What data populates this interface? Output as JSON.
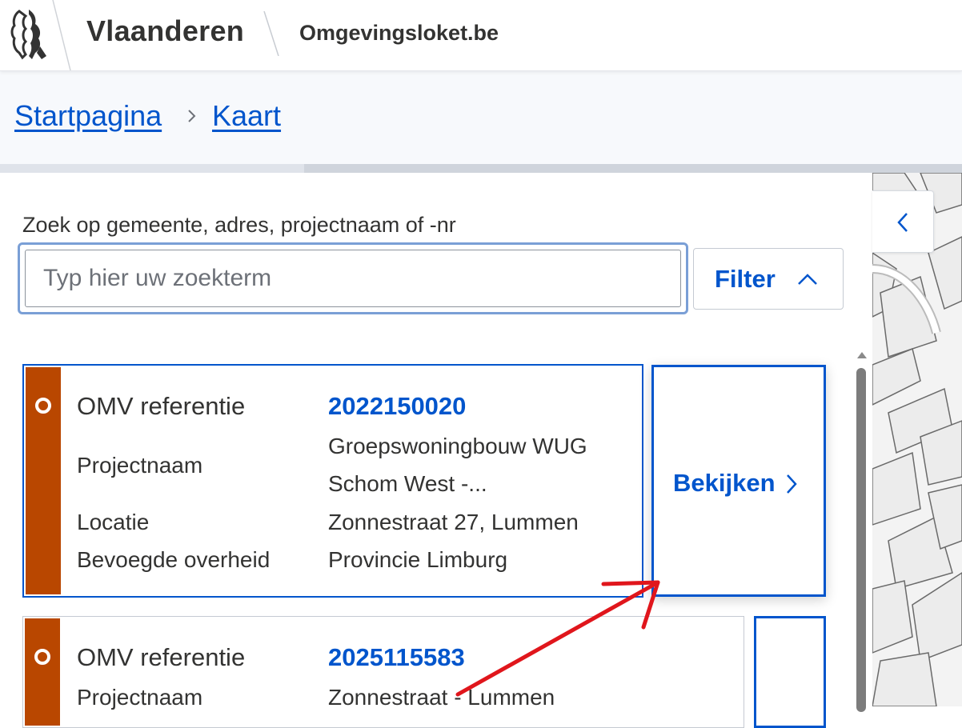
{
  "header": {
    "brand": "Vlaanderen",
    "site": "Omgevingsloket.be",
    "logo_icon": "flemish-lion-logo-icon"
  },
  "breadcrumb": {
    "items": [
      "Startpagina",
      "Kaart"
    ],
    "separator_icon": "chevron-right-icon"
  },
  "search": {
    "label": "Zoek op gemeente, adres, projectnaam of -nr",
    "placeholder": "Typ hier uw zoekterm",
    "value": ""
  },
  "filter": {
    "label": "Filter",
    "icon": "chevron-up-icon"
  },
  "map": {
    "collapse_icon": "chevron-left-icon"
  },
  "results": [
    {
      "fields": {
        "ref_label": "OMV referentie",
        "ref_value": "2022150020",
        "project_label": "Projectnaam",
        "project_value_1": "Groepswoningbouw WUG",
        "project_value_2": "Schom West -...",
        "location_label": "Locatie",
        "location_value": "Zonnestraat 27, Lummen",
        "authority_label": "Bevoegde overheid",
        "authority_value": "Provincie Limburg"
      },
      "action": "Bekijken",
      "status_color": "#b94700"
    },
    {
      "fields": {
        "ref_label": "OMV referentie",
        "ref_value": "2025115583",
        "project_label": "Projectnaam",
        "project_value_1": "Zonnestraat - Lummen"
      },
      "status_color": "#b94700"
    }
  ],
  "colors": {
    "accent": "#0055cc",
    "status": "#b94700",
    "annotation_arrow": "#e0161c"
  }
}
